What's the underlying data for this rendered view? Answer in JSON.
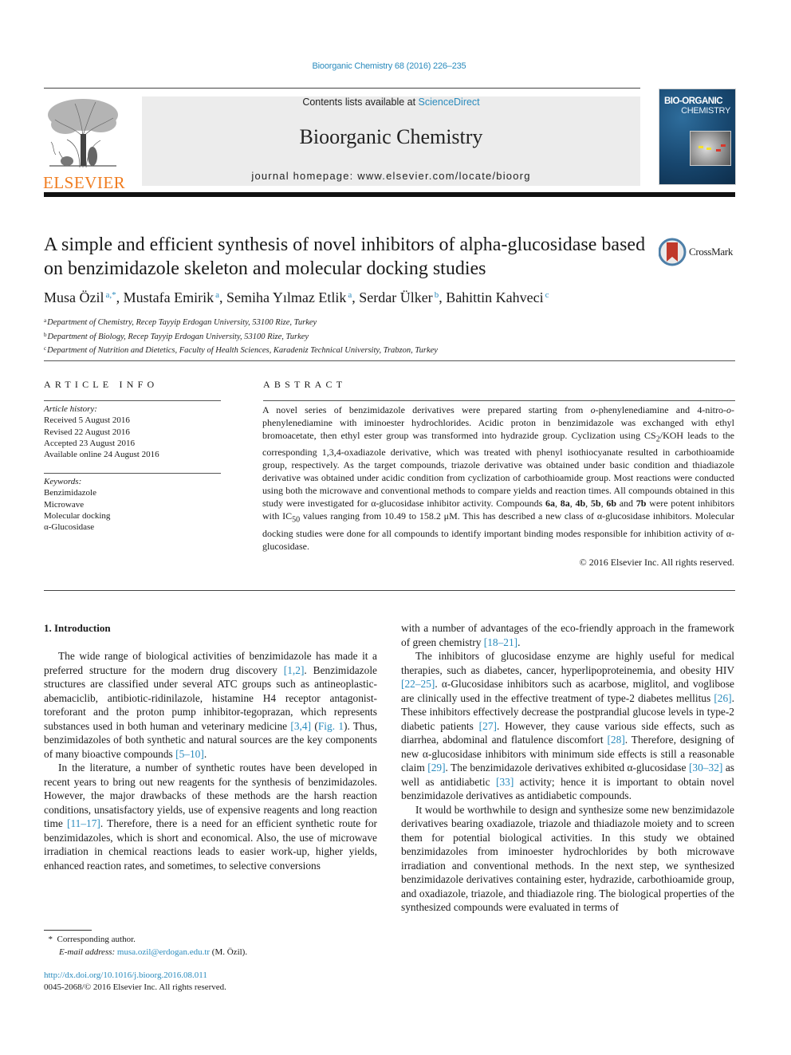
{
  "header": {
    "journal_ref": "Bioorganic Chemistry 68 (2016) 226–235",
    "contents_prefix": "Contents lists available at ",
    "contents_link": "ScienceDirect",
    "journal_title": "Bioorganic Chemistry",
    "homepage": "journal homepage: www.elsevier.com/locate/bioorg",
    "publisher_logo_text": "ELSEVIER",
    "cover_title_line1": "BIO-ORGANIC",
    "cover_title_line2": "CHEMISTRY"
  },
  "colors": {
    "link": "#2a8bbd",
    "elsevier_orange": "#f07c1e",
    "masthead_bg": "#ececec",
    "cover_blue": "#17466e",
    "crossmark_red": "#c0392b"
  },
  "article": {
    "title": "A simple and efficient synthesis of novel inhibitors of alpha-glucosidase based on benzimidazole skeleton and molecular docking studies",
    "crossmark_label": "CrossMark",
    "authors": [
      {
        "name": "Musa Özil",
        "sup": "a,*"
      },
      {
        "name": "Mustafa Emirik",
        "sup": "a"
      },
      {
        "name": "Semiha Yılmaz Etlik",
        "sup": "a"
      },
      {
        "name": "Serdar Ülker",
        "sup": "b"
      },
      {
        "name": "Bahittin Kahveci",
        "sup": "c"
      }
    ],
    "affiliations": [
      {
        "key": "a",
        "text": "Department of Chemistry, Recep Tayyip Erdogan University, 53100 Rize, Turkey"
      },
      {
        "key": "b",
        "text": "Department of Biology, Recep Tayyip Erdogan University, 53100 Rize, Turkey"
      },
      {
        "key": "c",
        "text": "Department of Nutrition and Dietetics, Faculty of Health Sciences, Karadeniz Technical University, Trabzon, Turkey"
      }
    ]
  },
  "article_info": {
    "heading": "ARTICLE INFO",
    "history_label": "Article history:",
    "history": [
      "Received 5 August 2016",
      "Revised 22 August 2016",
      "Accepted 23 August 2016",
      "Available online 24 August 2016"
    ],
    "keywords_label": "Keywords:",
    "keywords": [
      "Benzimidazole",
      "Microwave",
      "Molecular docking",
      "α-Glucosidase"
    ]
  },
  "abstract": {
    "heading": "ABSTRACT",
    "p1": "A novel series of benzimidazole derivatives were prepared starting from ",
    "o1": "o",
    "p2": "-phenylenediamine and 4-nitro-",
    "o2": "o",
    "p3": "-phenylenediamine with iminoester hydrochlorides. Acidic proton in benzimidazole was exchanged with ethyl bromoacetate, then ethyl ester group was transformed into hydrazide group. Cyclization using CS",
    "sub_cs": "2",
    "p4": "/KOH leads to the corresponding 1,3,4-oxadiazole derivative, which was treated with phenyl isothiocyanate resulted in carbothioamide group, respectively. As the target compounds, triazole derivative was obtained under basic condition and thiadiazole derivative was obtained under acidic condition from cyclization of carbothioamide group. Most reactions were conducted using both the microwave and conventional methods to compare yields and reaction times. All compounds obtained in this study were investigated for α-glucosidase inhibitor activity. Compounds ",
    "c1": "6a",
    "sep1": ", ",
    "c2": "8a",
    "sep2": ", ",
    "c3": "4b",
    "sep3": ", ",
    "c4": "5b",
    "sep4": ", ",
    "c5": "6b",
    "sep5": " and ",
    "c6": "7b",
    "p5": " were potent inhibitors with IC",
    "sub_ic": "50",
    "p6": " values ranging from 10.49 to 158.2 μM. This has described a new class of α-glucosidase inhibitors. Molecular docking studies were done for all compounds to identify important binding modes responsible for inhibition activity of α-glucosidase.",
    "copyright": "© 2016 Elsevier Inc. All rights reserved."
  },
  "intro": {
    "heading": "1. Introduction",
    "left": {
      "p1a": "The wide range of biological activities of benzimidazole has made it a preferred structure for the modern drug discovery ",
      "r1": "[1,2]",
      "p1b": ". Benzimidazole structures are classified under several ATC groups such as antineoplastic-abemaciclib, antibiotic-ridinilazole, histamine H4 receptor antagonist-toreforant and the proton pump inhibitor-tegoprazan, which represents substances used in both human and veterinary medicine ",
      "r2": "[3,4]",
      "p1c": " (",
      "r3": "Fig. 1",
      "p1d": "). Thus, benzimidazoles of both synthetic and natural sources are the key components of many bioactive compounds ",
      "r4": "[5–10]",
      "p1e": ".",
      "p2a": "In the literature, a number of synthetic routes have been developed in recent years to bring out new reagents for the synthesis of benzimidazoles. However, the major drawbacks of these methods are the harsh reaction conditions, unsatisfactory yields, use of expensive reagents and long reaction time ",
      "r5": "[11–17]",
      "p2b": ". Therefore, there is a need for an efficient synthetic route for benzimidazoles, which is short and economical. Also, the use of microwave irradiation in chemical reactions leads to easier work-up, higher yields, enhanced reaction rates, and sometimes, to selective conversions"
    },
    "right": {
      "p0a": "with a number of advantages of the eco-friendly approach in the framework of green chemistry ",
      "r0": "[18–21]",
      "p0b": ".",
      "p1a": "The inhibitors of glucosidase enzyme are highly useful for medical therapies, such as diabetes, cancer, hyperlipoproteinemia, and obesity HIV ",
      "r1": "[22–25]",
      "p1b": ". α-Glucosidase inhibitors such as acarbose, miglitol, and voglibose are clinically used in the effective treatment of type-2 diabetes mellitus ",
      "r2": "[26]",
      "p1c": ". These inhibitors effectively decrease the postprandial glucose levels in type-2 diabetic patients ",
      "r3": "[27]",
      "p1d": ". However, they cause various side effects, such as diarrhea, abdominal and flatulence discomfort ",
      "r4": "[28]",
      "p1e": ". Therefore, designing of new α-glucosidase inhibitors with minimum side effects is still a reasonable claim ",
      "r5": "[29]",
      "p1f": ". The benzimidazole derivatives exhibited α-glucosidase ",
      "r6": "[30–32]",
      "p1g": " as well as antidiabetic ",
      "r7": "[33]",
      "p1h": " activity; hence it is important to obtain novel benzimidazole derivatives as antidiabetic compounds.",
      "p2": "It would be worthwhile to design and synthesize some new benzimidazole derivatives bearing oxadiazole, triazole and thiadiazole moiety and to screen them for potential biological activities. In this study we obtained benzimidazoles from iminoester hydrochlorides by both microwave irradiation and conventional methods. In the next step, we synthesized benzimidazole derivatives containing ester, hydrazide, carbothioamide group, and oxadiazole, triazole, and thiadiazole ring. The biological properties of the synthesized compounds were evaluated in terms of"
    }
  },
  "footnotes": {
    "corresponding_mark": "*",
    "corresponding": "Corresponding author.",
    "email_label": "E-mail address: ",
    "email": "musa.ozil@erdogan.edu.tr",
    "email_suffix": " (M. Özil).",
    "doi": "http://dx.doi.org/10.1016/j.bioorg.2016.08.011",
    "issn_line": "0045-2068/© 2016 Elsevier Inc. All rights reserved."
  }
}
